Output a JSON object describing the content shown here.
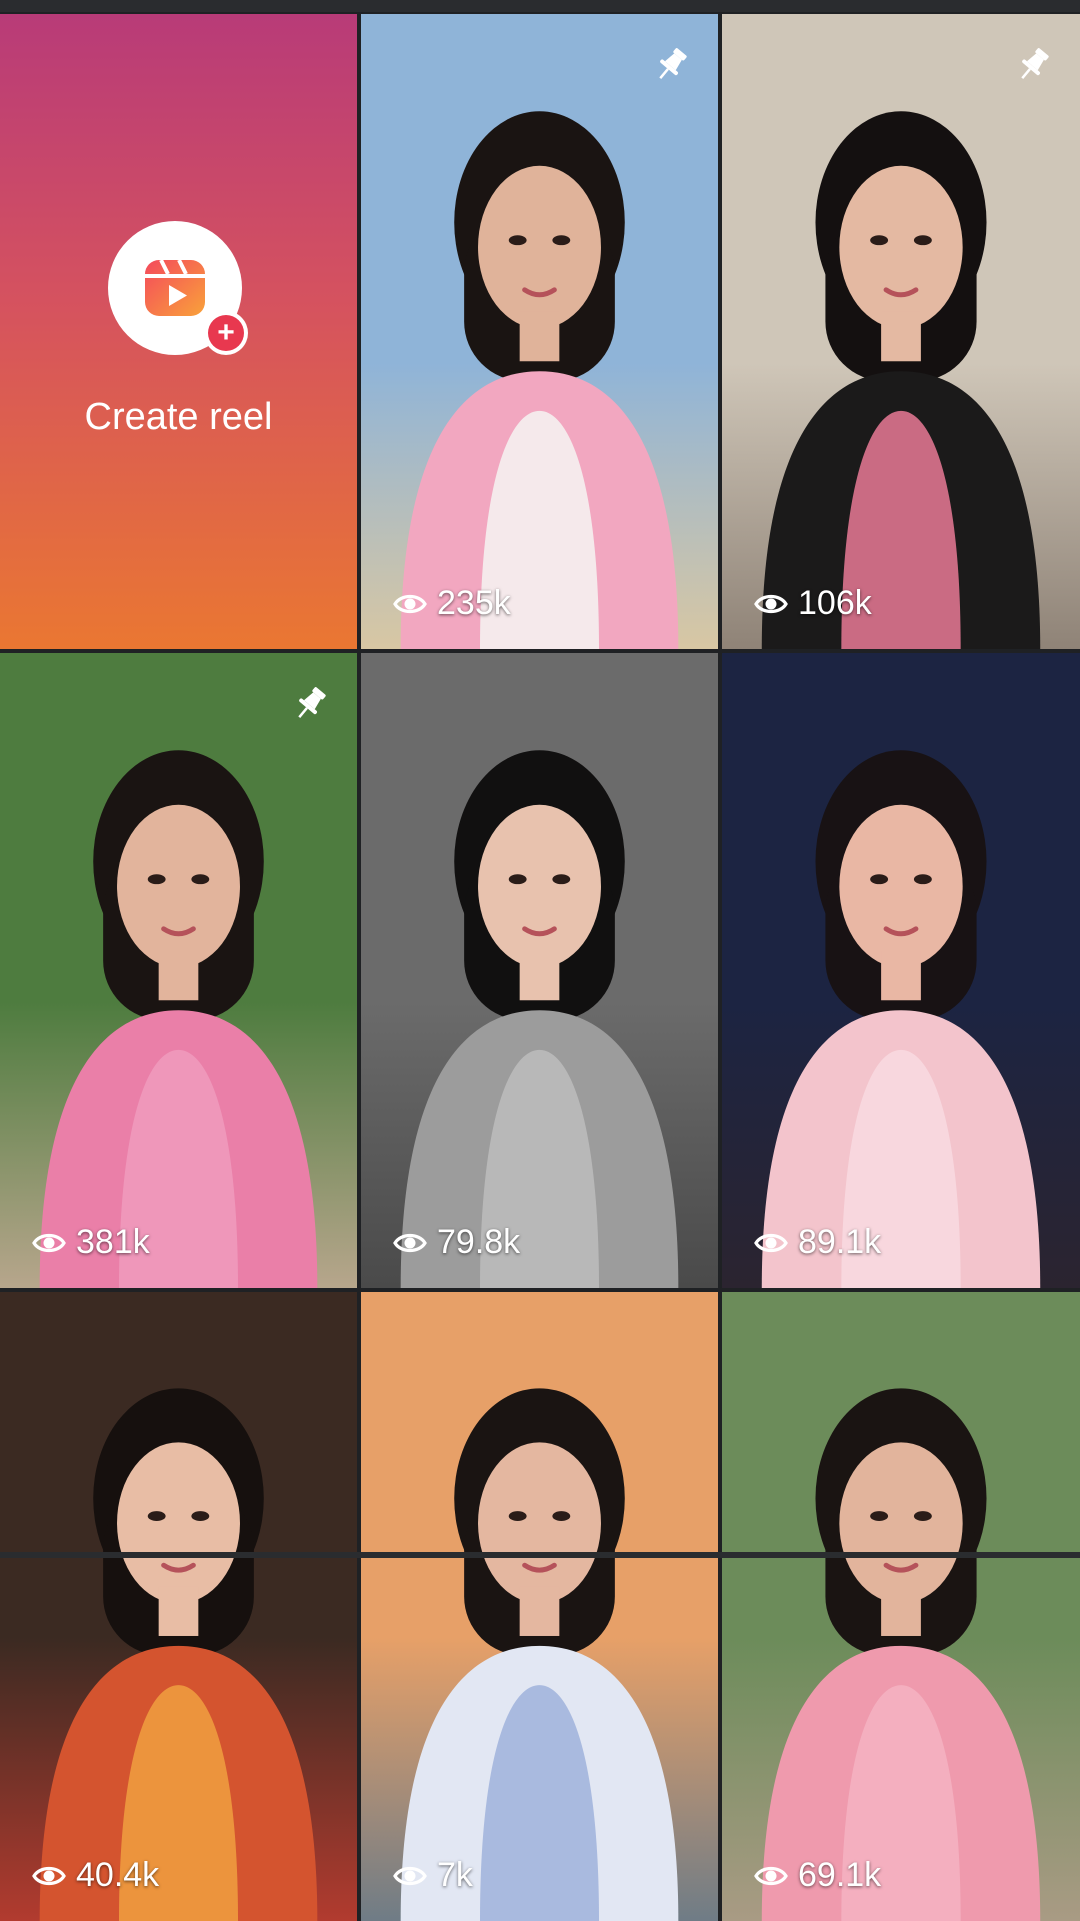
{
  "create_reel": {
    "label": "Create reel"
  },
  "reels": [
    {
      "views": "235k",
      "pinned": true,
      "scene": "beach",
      "palette": {
        "bg": "#8fb4d8",
        "ground": "#d8c7a3",
        "hair": "#1a1412",
        "skin": "#e0b39a",
        "top": "#f2a7c0",
        "shirt": "#f6f4f2"
      }
    },
    {
      "views": "106k",
      "pinned": true,
      "scene": "indoor",
      "palette": {
        "bg": "#cfc6b8",
        "ground": "#8f8377",
        "hair": "#141010",
        "skin": "#e4b9a2",
        "top": "#1b1a1a",
        "shirt": "#e97a97"
      }
    },
    {
      "views": "381k",
      "pinned": true,
      "scene": "village",
      "palette": {
        "bg": "#4e7c3f",
        "ground": "#b7a68c",
        "hair": "#1a1412",
        "skin": "#e2b49c",
        "top": "#ea7fa8",
        "shirt": "#f09bbd"
      }
    },
    {
      "views": "79.8k",
      "pinned": false,
      "scene": "grey",
      "palette": {
        "bg": "#6b6b6b",
        "ground": "#4a4a4a",
        "hair": "#111010",
        "skin": "#e8c2ae",
        "top": "#9c9c9c",
        "shirt": "#bdbdbd"
      }
    },
    {
      "views": "89.1k",
      "pinned": false,
      "scene": "night",
      "palette": {
        "bg": "#1c2442",
        "ground": "#2b2430",
        "hair": "#181214",
        "skin": "#e9b7a4",
        "top": "#f3c4cc",
        "shirt": "#f8dbe0"
      }
    },
    {
      "views": "40.4k",
      "pinned": false,
      "scene": "cafe",
      "palette": {
        "bg": "#3b2a22",
        "ground": "#b23b2f",
        "hair": "#16100e",
        "skin": "#e8bda5",
        "top": "#d4542f",
        "shirt": "#f0a040"
      }
    },
    {
      "views": "7k",
      "pinned": false,
      "scene": "sunset",
      "palette": {
        "bg": "#e7a068",
        "ground": "#6f7c86",
        "hair": "#1a1412",
        "skin": "#e4b7a0",
        "top": "#e2e7f3",
        "shirt": "#9fb2db"
      }
    },
    {
      "views": "69.1k",
      "pinned": false,
      "scene": "village2",
      "palette": {
        "bg": "#6c8c5a",
        "ground": "#a99b84",
        "hair": "#1a1412",
        "skin": "#e2b49c",
        "top": "#ef9aad",
        "shirt": "#f5b3c2"
      }
    }
  ]
}
